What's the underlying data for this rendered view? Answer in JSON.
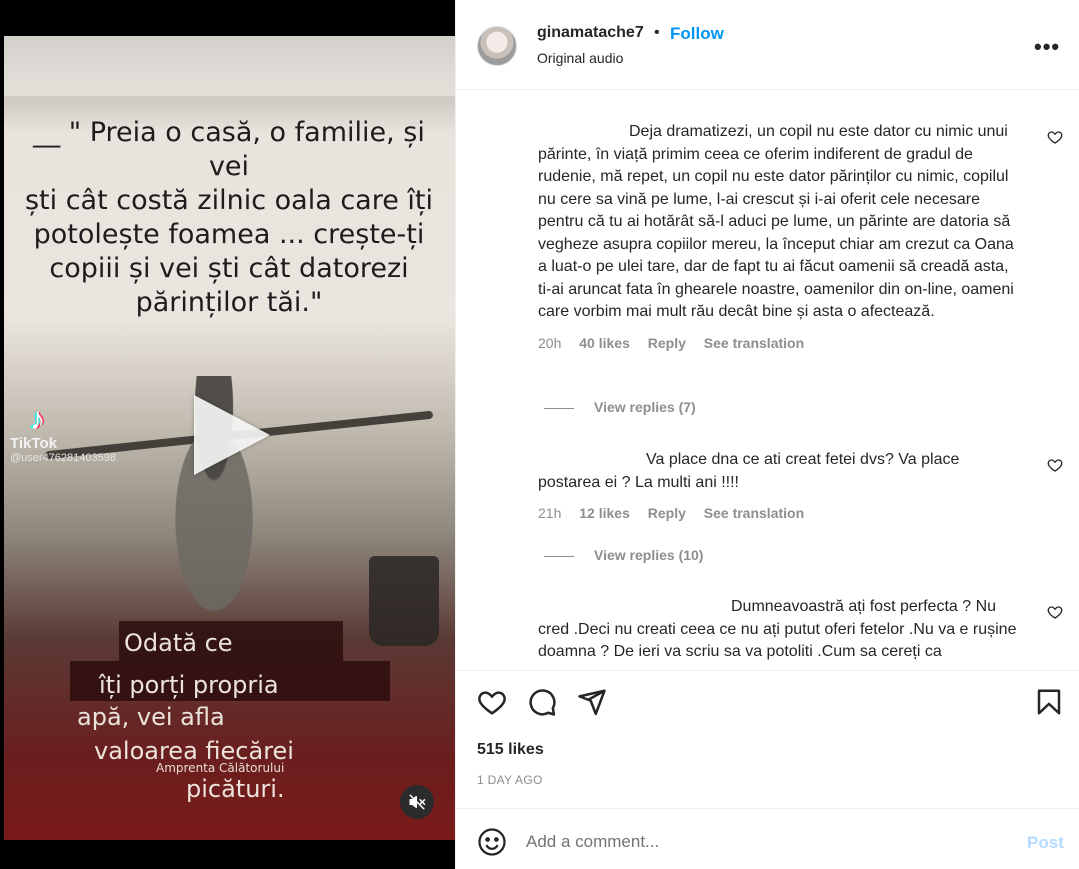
{
  "media": {
    "quote_lines": [
      "__ \" Preia o casă, o familie, și vei",
      "ști cât costă zilnic oala care îți",
      "potolește foamea ... crește-ți",
      "copiii și vei ști cât datorezi",
      "părinților tăi.\""
    ],
    "caption_lines": [
      "Odată ce",
      "îți porți propria",
      "apă, vei  afla",
      "valoarea fiecărei",
      "picături."
    ],
    "watermark": "Amprenta Călătorului",
    "tiktok_brand": "TikTok",
    "tiktok_user": "@user476281403598",
    "icons": {
      "play": "play-icon",
      "mute": "muted-speaker-icon",
      "tiktok": "tiktok-logo-icon"
    }
  },
  "header": {
    "username": "ginamatache7",
    "separator": "•",
    "follow_label": "Follow",
    "subtitle": "Original audio",
    "more_label": "•••"
  },
  "comments": [
    {
      "text": "Deja dramatizezi, un copil nu este dator cu nimic unui părinte, în viață primim ceea ce oferim indiferent de gradul de rudenie, mă repet, un copil nu este dator părinților cu nimic, copilul nu cere sa vină pe lume, l-ai crescut și i-ai oferit cele necesare pentru că tu ai hotărât să-l aduci pe lume, un părinte are datoria să vegheze asupra copiilor mereu, la început chiar am crezut ca Oana a luat-o pe ulei tare, dar de fapt tu ai făcut oamenii să creadă asta, ti-ai aruncat fata în ghearele noastre, oamenilor din on-line, oameni care vorbim mai mult rău decât bine și asta o afectează.",
      "time": "20h",
      "likes": "40 likes",
      "reply": "Reply",
      "translate": "See translation",
      "view_replies": "View replies (7)"
    },
    {
      "text": "Va place dna ce ati creat fetei dvs? Va place postarea ei ? La multi ani !!!!",
      "time": "21h",
      "likes": "12 likes",
      "reply": "Reply",
      "translate": "See translation",
      "view_replies": "View replies (10)"
    },
    {
      "text": "Dumneavoastră ați fost perfecta ? Nu cred .Deci nu creati ceea ce nu ați putut oferi fetelor .Nu va e rușine doamna ? De ieri va scriu sa va potoliti .Cum sa cereți ca"
    }
  ],
  "actions": {
    "icons": [
      "heart-icon",
      "comment-icon",
      "share-icon",
      "bookmark-icon"
    ],
    "likes_count": "515 likes",
    "timestamp": "1 DAY AGO"
  },
  "add_comment": {
    "placeholder": "Add a comment...",
    "post_label": "Post"
  },
  "colors": {
    "accent": "#0095f6",
    "post_disabled": "#b3dbff",
    "text": "#262626",
    "muted": "#8e8e8e"
  }
}
